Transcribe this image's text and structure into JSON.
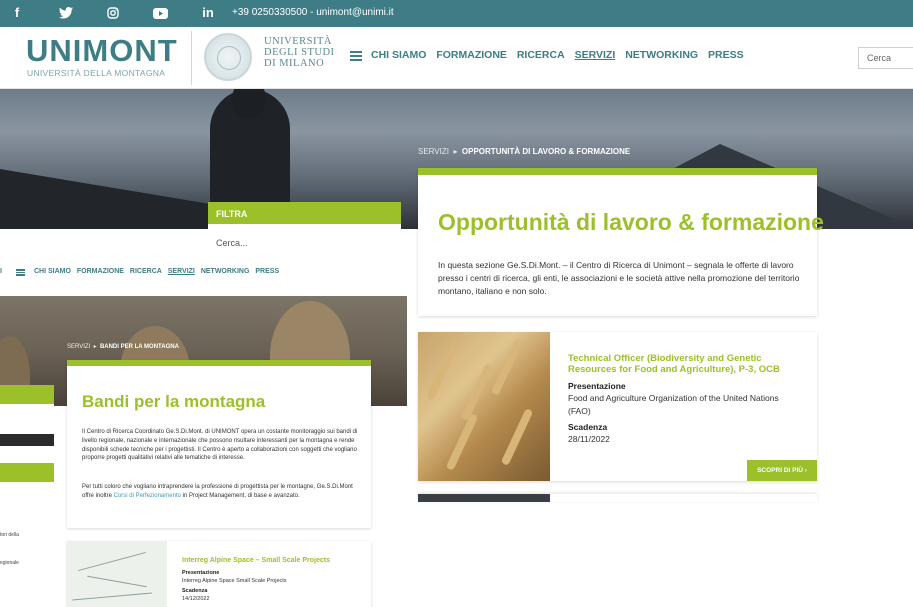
{
  "topbar": {
    "contact": "+39 0250330500 - unimont@unimi.it",
    "icons": [
      "facebook-icon",
      "twitter-icon",
      "instagram-icon",
      "youtube-icon",
      "linkedin-icon"
    ],
    "linkedin_label": "in"
  },
  "header": {
    "logo": "UNIMONT",
    "logo_sub": "UNIVERSITÀ DELLA MONTAGNA",
    "univ_line1": "UNIVERSITÀ",
    "univ_line2": "DEGLI STUDI",
    "univ_line3": "DI MILANO",
    "nav": [
      "CHI SIAMO",
      "FORMAZIONE",
      "RICERCA",
      "SERVIZI",
      "NETWORKING",
      "PRESS"
    ],
    "nav_active": "SERVIZI",
    "search_placeholder": "Cerca"
  },
  "front": {
    "crumb_root": "SERVIZI",
    "crumb_sep": "▸",
    "crumb_current": "OPPORTUNITÀ DI LAVORO & FORMAZIONE",
    "title": "Opportunità di lavoro & formazione",
    "intro": "In questa sezione Ge.S.Di.Mont. – il Centro di Ricerca di Unimont – segnala le offerte di lavoro presso i centri di ricerca, gli enti, le associazioni e le società attive nella promozione del territorio montano, italiano e non solo.",
    "filter_title": "FILTRA",
    "filter_placeholder": "Cerca...",
    "job": {
      "title": "Technical Officer (Biodiversity and Genetic Resources for Food and Agriculture), P-3, OCB",
      "presentazione_label": "Presentazione",
      "presentazione": "Food and Agriculture Organization of the United Nations (FAO)",
      "scadenza_label": "Scadenza",
      "scadenza": "28/11/2022",
      "button": "SCOPRI DI PIÙ ›"
    }
  },
  "back": {
    "nav_first": "I",
    "nav": [
      "CHI SIAMO",
      "FORMAZIONE",
      "RICERCA",
      "SERVIZI",
      "NETWORKING",
      "PRESS"
    ],
    "nav_active": "SERVIZI",
    "crumb_root": "SERVIZI",
    "crumb_sep": "▸",
    "crumb_current": "BANDI PER LA MONTAGNA",
    "title": "Bandi per la montagna",
    "para1": "Il Centro di Ricerca Coordinato Ge.S.Di.Mont. di UNIMONT opera un costante monitoraggio sui bandi di livello regionale, nazionale e internazionale che possono risultare interessanti per la montagna e rende disponibili schede tecniche per i progettisti. Il Centro è aperto a collaborazioni con soggetti che vogliano proporre progetti qualitativi relativi alle tematiche di interesse.",
    "para2_start": "Per tutti coloro che vogliano intraprendere la professione di progettista per le montagne, Ge.S.Di.Mont offre inoltre ",
    "para2_link": "Corsi di Perfezionamento",
    "para2_end": " in Project Management, di base e avanzato.",
    "left_text1": "tori della",
    "left_text2": "egionale",
    "item": {
      "title": "Interreg Alpine Space – Small Scale Projects",
      "presentazione_label": "Presentazione",
      "presentazione": "Interreg Alpine Space Small Scale Projects",
      "scadenza_label": "Scadenza",
      "scadenza": "14/12/2022"
    }
  },
  "colors": {
    "teal": "#3e7d86",
    "green": "#9cc02a"
  }
}
